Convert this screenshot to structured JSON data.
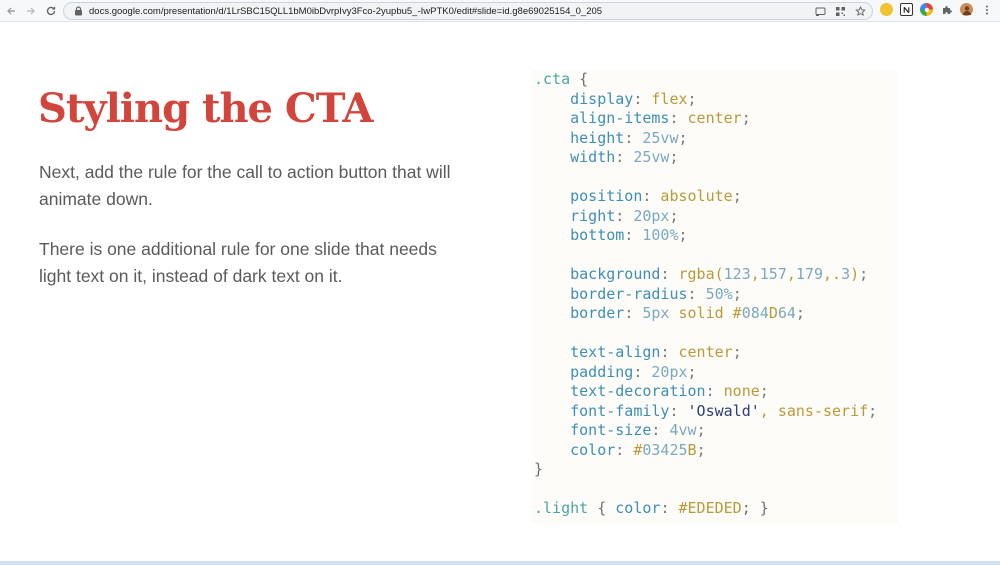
{
  "browser": {
    "url": "docs.google.com/presentation/d/1LrSBC15QLL1bM0ibDvrpIvy3Fco-2yupbu5_-IwPTK0/edit#slide=id.g8e69025154_0_205",
    "icons": [
      "back-icon",
      "forward-icon",
      "reload-icon",
      "lock-icon",
      "cast-icon",
      "qr-icon",
      "bookmark-star-icon",
      "extension-yellow-icon",
      "notion-icon",
      "colorful-extension-icon",
      "puzzle-icon",
      "profile-avatar",
      "kebab-menu-icon"
    ]
  },
  "slide": {
    "title": "Styling the CTA",
    "paragraph1": "Next, add the rule for the call to action button that will animate down.",
    "paragraph2": "There is one additional rule for one slide that needs light text on it, instead of dark text on it.",
    "code_lines": [
      ".cta {",
      "    display: flex;",
      "    align-items: center;",
      "    height: 25vw;",
      "    width: 25vw;",
      "",
      "    position: absolute;",
      "    right: 20px;",
      "    bottom: 100%;",
      "",
      "    background: rgba(123,157,179,.3);",
      "    border-radius: 50%;",
      "    border: 5px solid #084D64;",
      "",
      "    text-align: center;",
      "    padding: 20px;",
      "    text-decoration: none;",
      "    font-family: 'Oswald', sans-serif;",
      "    font-size: 4vw;",
      "    color: #03425B;",
      "}",
      "",
      ".light { color: #EDEDED; }"
    ],
    "colors": {
      "title": "#d2453c",
      "body_text": "#5a5a5a",
      "selector": "#4aa6a6",
      "property": "#3e8fb5",
      "value": "#b99a3b"
    }
  }
}
